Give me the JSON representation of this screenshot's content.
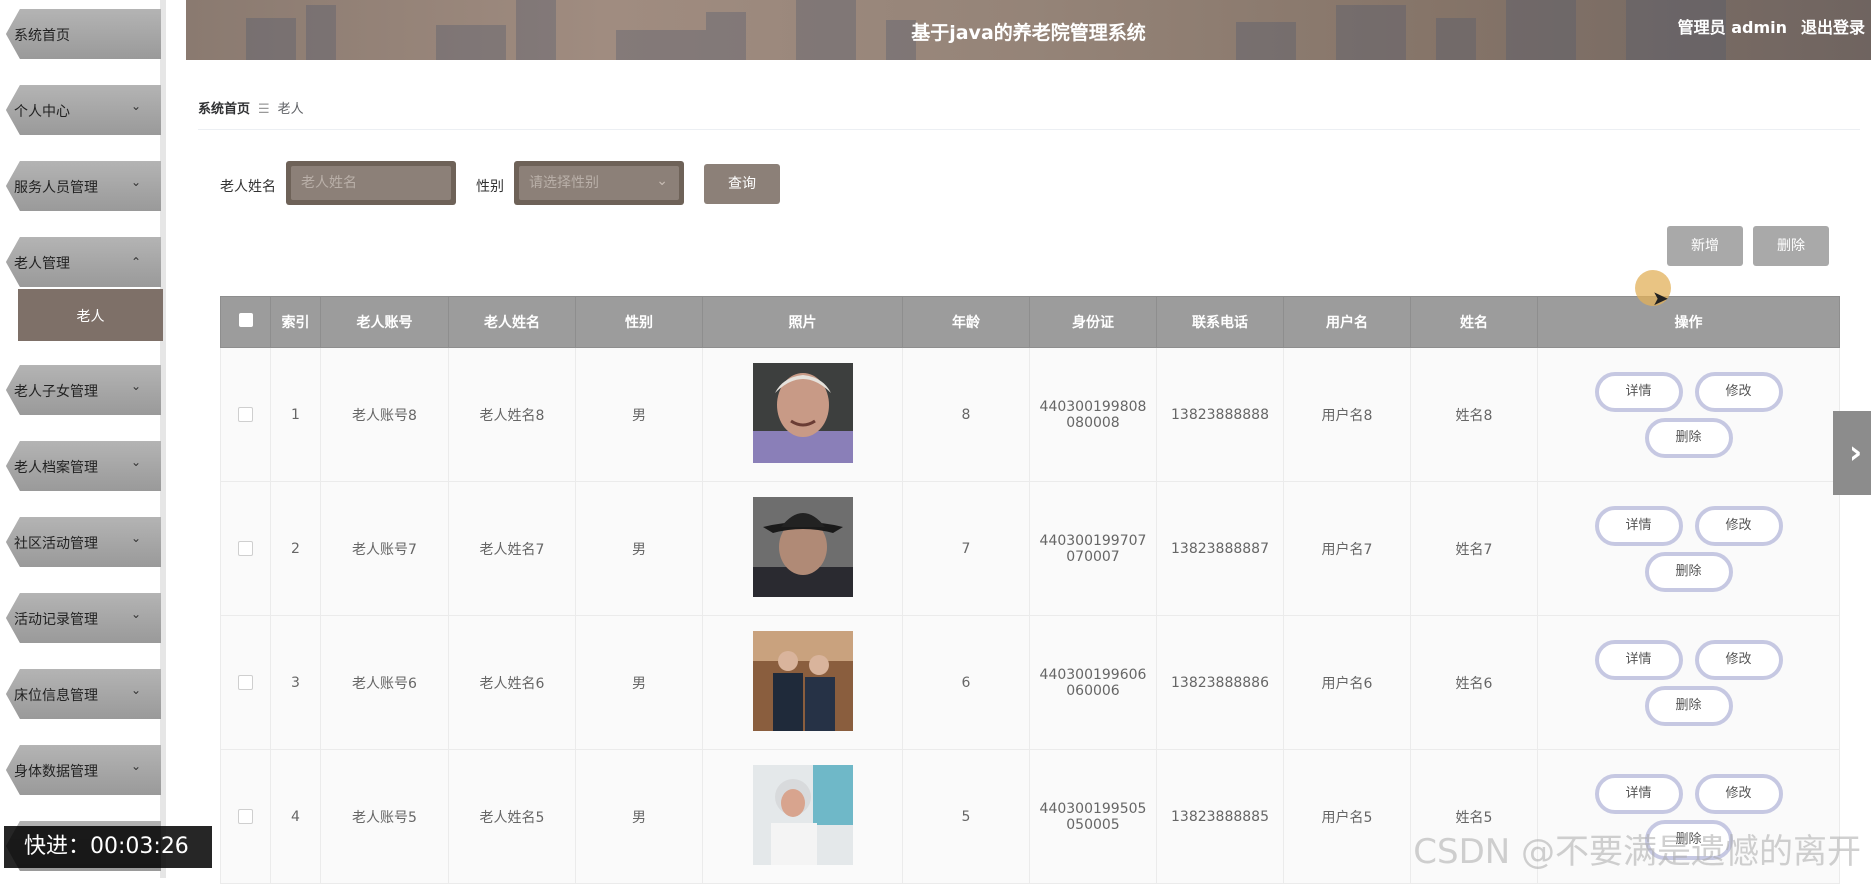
{
  "header": {
    "title": "基于java的养老院管理系统",
    "user": "管理员 admin",
    "logout": "退出登录"
  },
  "sidebar": {
    "items": [
      {
        "label": "系统首页",
        "expandable": false
      },
      {
        "label": "个人中心",
        "expandable": true
      },
      {
        "label": "服务人员管理",
        "expandable": true
      },
      {
        "label": "老人管理",
        "expandable": true,
        "expanded": true
      },
      {
        "label": "老人子女管理",
        "expandable": true
      },
      {
        "label": "老人档案管理",
        "expandable": true
      },
      {
        "label": "社区活动管理",
        "expandable": true
      },
      {
        "label": "活动记录管理",
        "expandable": true
      },
      {
        "label": "床位信息管理",
        "expandable": true
      },
      {
        "label": "身体数据管理",
        "expandable": true
      }
    ],
    "active_sub": "老人"
  },
  "breadcrumb": {
    "home": "系统首页",
    "sep": "☰",
    "current": "老人"
  },
  "search": {
    "name_label": "老人姓名",
    "name_placeholder": "老人姓名",
    "gender_label": "性别",
    "gender_placeholder": "请选择性别",
    "query_button": "查询"
  },
  "toolbar": {
    "add": "新增",
    "delete": "删除"
  },
  "table": {
    "headers": [
      "索引",
      "老人账号",
      "老人姓名",
      "性别",
      "照片",
      "年龄",
      "身份证",
      "联系电话",
      "用户名",
      "姓名",
      "操作"
    ],
    "rows": [
      {
        "index": "1",
        "account": "老人账号8",
        "name": "老人姓名8",
        "gender": "男",
        "age": "8",
        "id1": "440300199808",
        "id2": "080008",
        "phone": "13823888888",
        "username": "用户名8",
        "fullname": "姓名8"
      },
      {
        "index": "2",
        "account": "老人账号7",
        "name": "老人姓名7",
        "gender": "男",
        "age": "7",
        "id1": "440300199707",
        "id2": "070007",
        "phone": "13823888887",
        "username": "用户名7",
        "fullname": "姓名7"
      },
      {
        "index": "3",
        "account": "老人账号6",
        "name": "老人姓名6",
        "gender": "男",
        "age": "6",
        "id1": "440300199606",
        "id2": "060006",
        "phone": "13823888886",
        "username": "用户名6",
        "fullname": "姓名6"
      },
      {
        "index": "4",
        "account": "老人账号5",
        "name": "老人姓名5",
        "gender": "男",
        "age": "5",
        "id1": "440300199505",
        "id2": "050005",
        "phone": "13823888885",
        "username": "用户名5",
        "fullname": "姓名5"
      }
    ],
    "actions": {
      "detail": "详情",
      "edit": "修改",
      "delete": "删除"
    }
  },
  "overlay": {
    "fast_forward": "快进：00:03:26",
    "watermark": "CSDN @不要满是遗憾的离开"
  },
  "colors": {
    "accent": "#8c8078",
    "header_table": "#9c9c9c",
    "action_border": "#c6c8e2",
    "submenu_active": "#7e7068"
  }
}
